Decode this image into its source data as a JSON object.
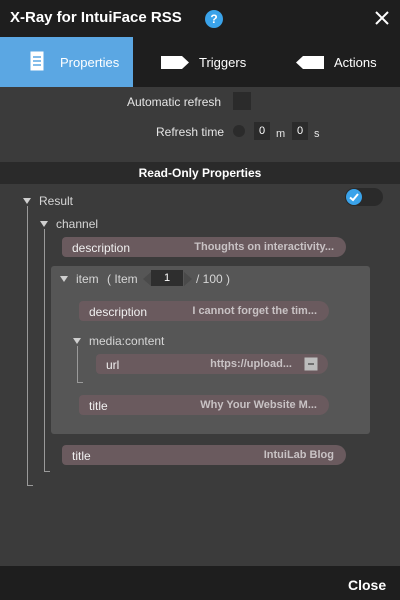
{
  "window": {
    "title": "X-Ray for IntuiFace RSS",
    "help_label": "?",
    "close_icon": "close-icon"
  },
  "tabs": [
    {
      "label": "Properties",
      "icon": "document-icon",
      "active": true
    },
    {
      "label": "Triggers",
      "icon": "trigger-arrow-icon",
      "active": false
    },
    {
      "label": "Actions",
      "icon": "action-arrow-icon",
      "active": false
    }
  ],
  "refresh": {
    "automatic_label": "Automatic refresh",
    "time_label": "Refresh time",
    "minutes": "0",
    "minutes_unit": "m",
    "seconds": "0",
    "seconds_unit": "s"
  },
  "section_title": "Read-Only Properties",
  "tree": {
    "result_label": "Result",
    "channel_label": "channel",
    "channel_description": {
      "key": "description",
      "value": "Thoughts on interactivity..."
    },
    "item": {
      "label": "item",
      "index_prefix": "( Item",
      "index_value": "1",
      "index_total": "/ 100 )",
      "description": {
        "key": "description",
        "value": "I cannot forget the tim..."
      },
      "media_label": "media:content",
      "url": {
        "key": "url",
        "value": "https://upload..."
      },
      "title": {
        "key": "title",
        "value": "Why Your Website M..."
      }
    },
    "channel_title": {
      "key": "title",
      "value": "IntuiLab Blog"
    }
  },
  "footer": {
    "close_label": "Close"
  },
  "colors": {
    "accent": "#5ba7e3",
    "toggle": "#3aa3ea",
    "pill": "#6a5a5e"
  }
}
